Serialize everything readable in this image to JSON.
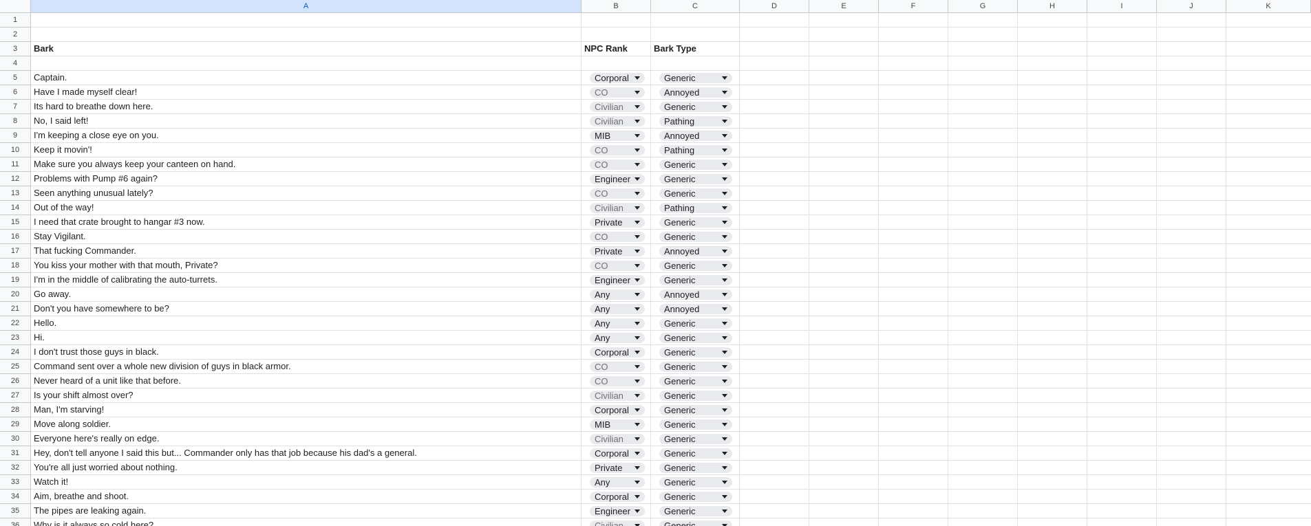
{
  "columns": [
    "A",
    "B",
    "C",
    "D",
    "E",
    "F",
    "G",
    "H",
    "I",
    "J",
    "K"
  ],
  "header_row": {
    "row": "3",
    "bark": "Bark",
    "npc_rank": "NPC Rank",
    "bark_type": "Bark Type"
  },
  "empty_rows": [
    "1",
    "2",
    "4"
  ],
  "barks": [
    {
      "row": "5",
      "text": "Captain.",
      "rank": "Corporal",
      "type": "Generic"
    },
    {
      "row": "6",
      "text": "Have I made myself clear!",
      "rank": "CO",
      "type": "Annoyed"
    },
    {
      "row": "7",
      "text": "Its hard to breathe down here.",
      "rank": "Civilian",
      "type": "Generic"
    },
    {
      "row": "8",
      "text": "No, I said left!",
      "rank": "Civilian",
      "type": "Pathing"
    },
    {
      "row": "9",
      "text": "I'm keeping a close eye on you.",
      "rank": "MIB",
      "type": "Annoyed"
    },
    {
      "row": "10",
      "text": "Keep it movin'!",
      "rank": "CO",
      "type": "Pathing"
    },
    {
      "row": "11",
      "text": "Make sure you always keep your canteen on hand.",
      "rank": "CO",
      "type": "Generic"
    },
    {
      "row": "12",
      "text": "Problems with Pump #6 again?",
      "rank": "Engineer",
      "type": "Generic"
    },
    {
      "row": "13",
      "text": "Seen anything unusual lately?",
      "rank": "CO",
      "type": "Generic"
    },
    {
      "row": "14",
      "text": "Out of the way!",
      "rank": "Civilian",
      "type": "Pathing"
    },
    {
      "row": "15",
      "text": "I need that crate brought to hangar #3 now.",
      "rank": "Private",
      "type": "Generic"
    },
    {
      "row": "16",
      "text": "Stay Vigilant.",
      "rank": "CO",
      "type": "Generic"
    },
    {
      "row": "17",
      "text": "That fucking Commander.",
      "rank": "Private",
      "type": "Annoyed"
    },
    {
      "row": "18",
      "text": "You kiss your mother with that mouth, Private?",
      "rank": "CO",
      "type": "Generic"
    },
    {
      "row": "19",
      "text": "I'm in the middle of calibrating the auto-turrets.",
      "rank": "Engineer",
      "type": "Generic"
    },
    {
      "row": "20",
      "text": "Go away.",
      "rank": "Any",
      "type": "Annoyed"
    },
    {
      "row": "21",
      "text": "Don't you have somewhere to be?",
      "rank": "Any",
      "type": "Annoyed"
    },
    {
      "row": "22",
      "text": "Hello.",
      "rank": "Any",
      "type": "Generic"
    },
    {
      "row": "23",
      "text": "Hi.",
      "rank": "Any",
      "type": "Generic"
    },
    {
      "row": "24",
      "text": "I don't trust those guys in black.",
      "rank": "Corporal",
      "type": "Generic"
    },
    {
      "row": "25",
      "text": "Command sent over a whole new division of guys in black armor.",
      "rank": "CO",
      "type": "Generic"
    },
    {
      "row": "26",
      "text": "Never heard of a unit like that before.",
      "rank": "CO",
      "type": "Generic"
    },
    {
      "row": "27",
      "text": "Is your shift almost over?",
      "rank": "Civilian",
      "type": "Generic"
    },
    {
      "row": "28",
      "text": "Man, I'm starving!",
      "rank": "Corporal",
      "type": "Generic"
    },
    {
      "row": "29",
      "text": "Move along soldier.",
      "rank": "MIB",
      "type": "Generic"
    },
    {
      "row": "30",
      "text": "Everyone here's really on edge.",
      "rank": "Civilian",
      "type": "Generic"
    },
    {
      "row": "31",
      "text": "Hey, don't tell anyone I said this but... Commander only has that job because his dad's a general.",
      "rank": "Corporal",
      "type": "Generic"
    },
    {
      "row": "32",
      "text": "You're all just worried about nothing.",
      "rank": "Private",
      "type": "Generic"
    },
    {
      "row": "33",
      "text": "Watch it!",
      "rank": "Any",
      "type": "Generic"
    },
    {
      "row": "34",
      "text": "Aim, breathe and shoot.",
      "rank": "Corporal",
      "type": "Generic"
    },
    {
      "row": "35",
      "text": "The pipes are leaking again.",
      "rank": "Engineer",
      "type": "Generic"
    },
    {
      "row": "36",
      "text": "Why is it always so cold here?",
      "rank": "Civilian",
      "type": "Generic"
    }
  ],
  "muted_ranks": [
    "CO",
    "Civilian"
  ],
  "colors": {
    "selected_column_header": "#d3e3fd",
    "chip_background": "#e8eaed",
    "muted_chip_text": "#707070",
    "gridline": "#e1e1e1"
  },
  "icons": {
    "dropdown": "dropdown-arrow-icon"
  }
}
